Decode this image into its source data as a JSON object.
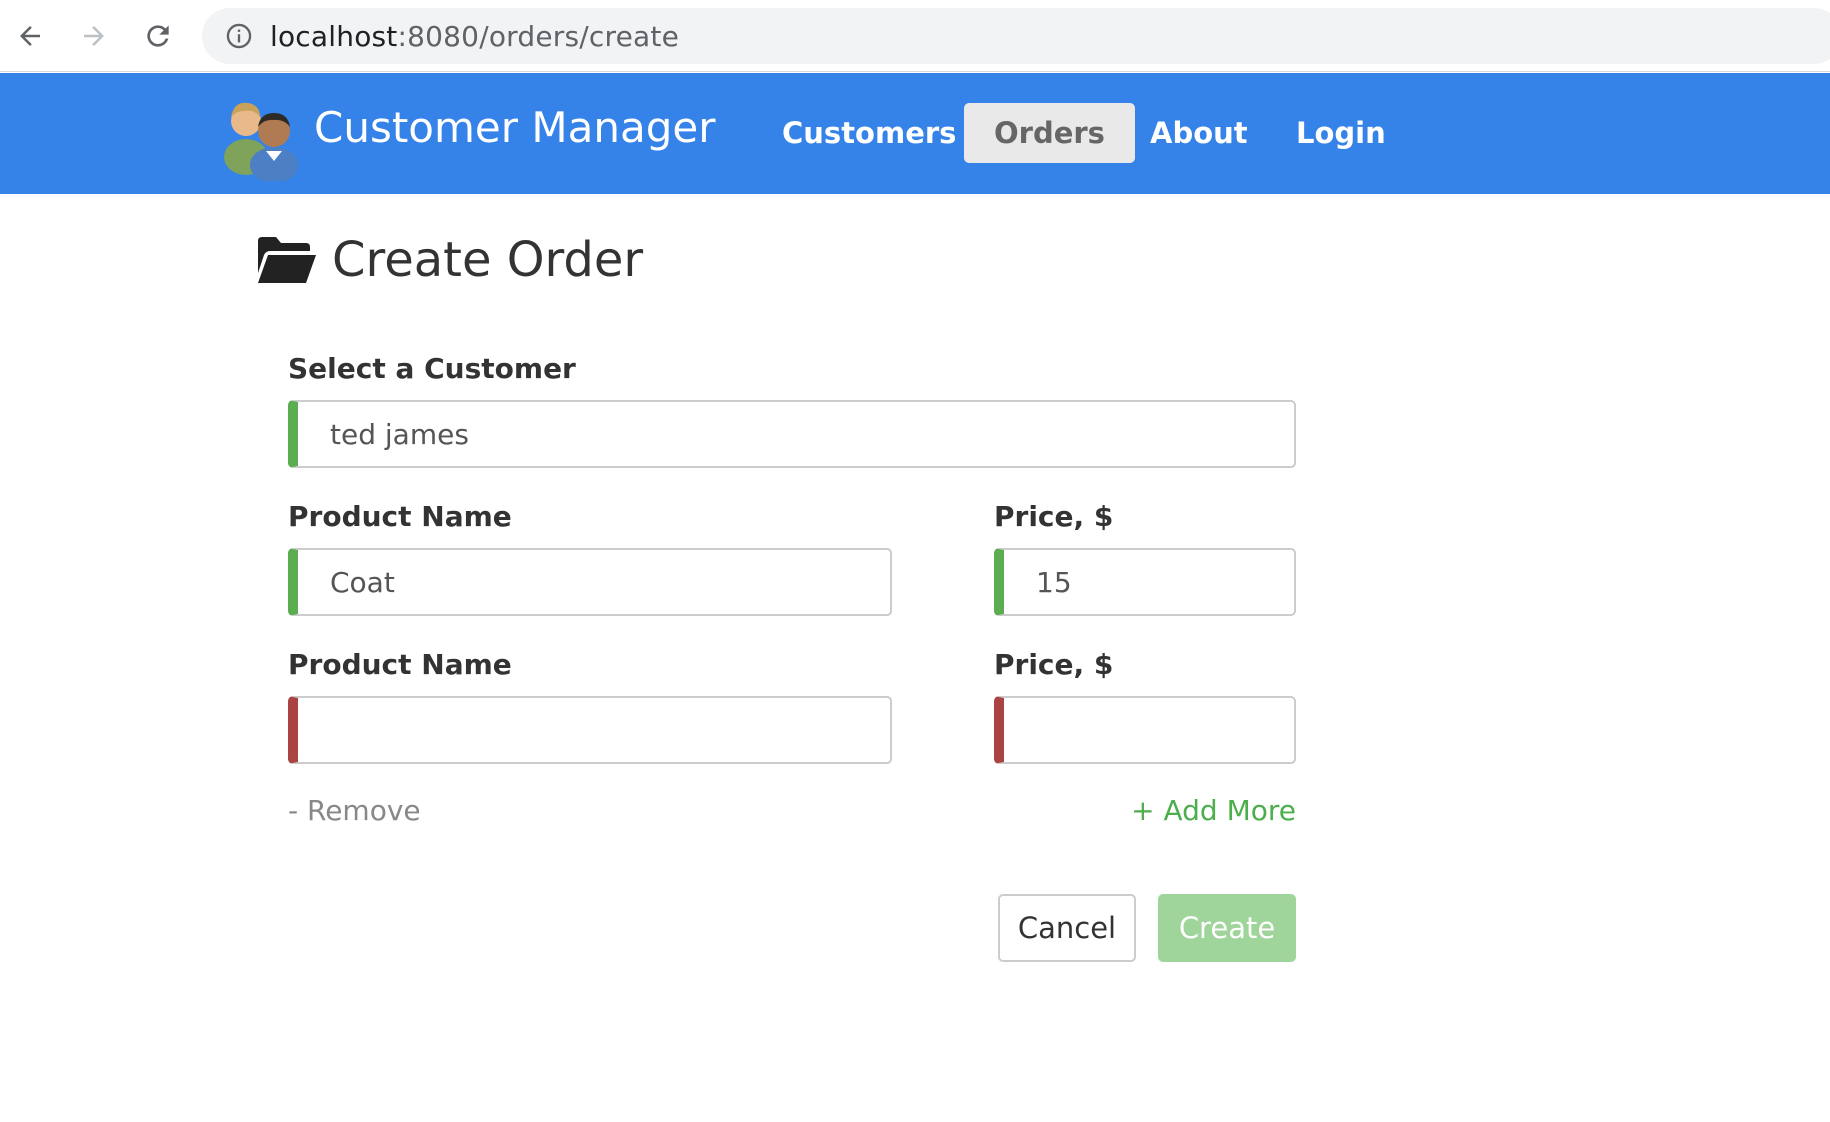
{
  "browser": {
    "url_host": "localhost",
    "url_rest": ":8080/orders/create"
  },
  "navbar": {
    "brand": "Customer Manager",
    "items": [
      {
        "label": "Customers",
        "active": false
      },
      {
        "label": "Orders",
        "active": true
      },
      {
        "label": "About",
        "active": false
      },
      {
        "label": "Login",
        "active": false
      }
    ],
    "color": "#3582e8"
  },
  "page": {
    "title": "Create Order",
    "customer": {
      "label": "Select a Customer",
      "value": "ted james"
    },
    "products": [
      {
        "name_label": "Product Name",
        "name_value": "Coat",
        "price_label": "Price, $",
        "price_value": "15",
        "valid": true
      },
      {
        "name_label": "Product Name",
        "name_value": "",
        "price_label": "Price, $",
        "price_value": "",
        "valid": false
      }
    ],
    "remove_label": "- Remove",
    "add_more_label": "+ Add More",
    "cancel_label": "Cancel",
    "create_label": "Create"
  },
  "colors": {
    "valid": "#5cad51",
    "invalid": "#a94442",
    "create_button": "#9fd49a"
  }
}
